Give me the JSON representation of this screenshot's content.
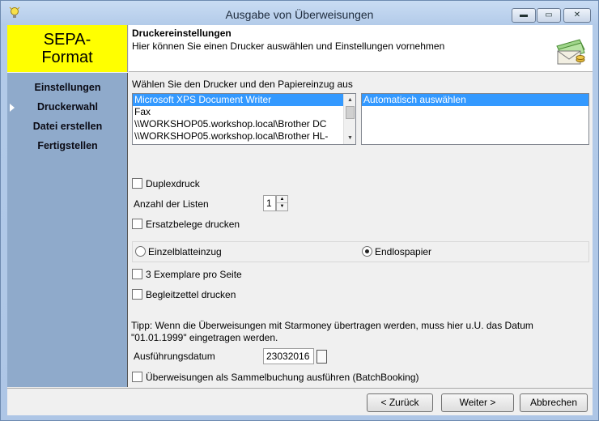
{
  "window": {
    "title": "Ausgabe von Überweisungen",
    "min_glyph": "▬",
    "max_glyph": "▭",
    "close_glyph": "✕"
  },
  "brand": {
    "line1": "SEPA-",
    "line2": "Format",
    "color": "#ffff00"
  },
  "header": {
    "title": "Druckereinstellungen",
    "subtitle": "Hier können Sie einen Drucker auswählen und Einstellungen vornehmen",
    "icon": "money-envelope-icon"
  },
  "nav": {
    "items": [
      {
        "label": "Einstellungen",
        "active": false
      },
      {
        "label": "Druckerwahl",
        "active": true
      },
      {
        "label": "Datei erstellen",
        "active": false
      },
      {
        "label": "Fertigstellen",
        "active": false
      }
    ],
    "background": "#8faacb"
  },
  "printer": {
    "section_label": "Wählen Sie den Drucker und den Papiereinzug aus",
    "printers": [
      "Microsoft XPS Document Writer",
      "Fax",
      "\\\\WORKSHOP05.workshop.local\\Brother DC",
      "\\\\WORKSHOP05.workshop.local\\Brother HL-"
    ],
    "selected_printer": 0,
    "trays": [
      "Automatisch auswählen"
    ],
    "selected_tray": 0
  },
  "options": {
    "duplex_label": "Duplexdruck",
    "duplex_checked": false,
    "list_count_label": "Anzahl der Listen",
    "list_count_value": "1",
    "replacement_label": "Ersatzbelege drucken",
    "replacement_checked": false,
    "feed_single_label": "Einzelblatteinzug",
    "feed_endless_label": "Endlospapier",
    "feed_selected": "endless",
    "three_copies_label": "3 Exemplare pro Seite",
    "three_copies_checked": false,
    "cover_label": "Begleitzettel drucken",
    "cover_checked": false,
    "tip_line1": "Tipp: Wenn die Überweisungen mit Starmoney übertragen werden, muss hier u.U. das Datum",
    "tip_line2": "\"01.01.1999\" eingetragen werden.",
    "date_label": "Ausführungsdatum",
    "date_value": "23032016",
    "batch_label": "Überweisungen als Sammelbuchung ausführen (BatchBooking)",
    "batch_checked": false
  },
  "footer": {
    "back_label": "< Zurück",
    "next_label": "Weiter >",
    "cancel_label": "Abbrechen"
  }
}
